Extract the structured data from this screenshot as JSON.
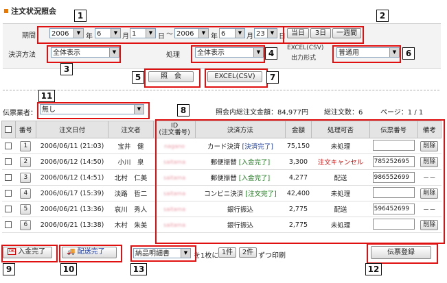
{
  "title": "注文状況照会",
  "period": {
    "label": "期間",
    "from_year": "2006",
    "from_month": "6",
    "from_day": "1",
    "to_year": "2006",
    "to_month": "6",
    "to_day": "23",
    "unit_year": "年",
    "unit_month": "月",
    "unit_day": "日",
    "sep": "～",
    "quick": [
      "当日",
      "3日",
      "一週間"
    ]
  },
  "payment": {
    "label": "決済方法",
    "value": "全体表示"
  },
  "process": {
    "label": "処理",
    "value": "全体表示"
  },
  "excel_format": {
    "label1": "EXCEL(CSV)",
    "label2": "出力形式",
    "value": "普通用"
  },
  "actions": {
    "search": "照　会",
    "excel": "EXCEL(CSV)"
  },
  "carrier": {
    "label": "伝票業者：",
    "value": "無し"
  },
  "summary": {
    "total_amount": "照会内総注文金額：84,977円",
    "total_count": "総注文数：6",
    "page": "ページ：1 / 1"
  },
  "columns": [
    "番号",
    "注文日付",
    "注文者",
    "ID\n(注文番号)",
    "決済方法",
    "金額",
    "処理可否",
    "伝票番号",
    "備考"
  ],
  "rows": [
    {
      "num": "1",
      "date": "2006/06/11 (21:03)",
      "name": "宝井　健",
      "id": "nagano",
      "pay": "カード決済",
      "pay_status": "[決済完了]",
      "pay_status_color": "#1f3fa0",
      "amount": "75,150",
      "status": "未処理",
      "status_color": "#222",
      "slip": "",
      "note": "削除"
    },
    {
      "num": "2",
      "date": "2006/06/12 (14:50)",
      "name": "小川　泉",
      "id": "saitama",
      "pay": "郵便振替",
      "pay_status": "[入金完了]",
      "pay_status_color": "#1a7a1a",
      "amount": "3,300",
      "status": "注文キャンセル",
      "status_color": "#d01010",
      "slip": "785252695",
      "note": "削除"
    },
    {
      "num": "3",
      "date": "2006/06/12 (14:51)",
      "name": "北村　仁美",
      "id": "saitama",
      "pay": "郵便振替",
      "pay_status": "[入金完了]",
      "pay_status_color": "#1a7a1a",
      "amount": "4,277",
      "status": "配送",
      "status_color": "#222",
      "slip": "986552699",
      "note": "－－"
    },
    {
      "num": "4",
      "date": "2006/06/17 (15:39)",
      "name": "淡路　哲二",
      "id": "saitama",
      "pay": "コンビニ決済",
      "pay_status": "[注文完了]",
      "pay_status_color": "#1a7a1a",
      "amount": "42,400",
      "status": "未処理",
      "status_color": "#222",
      "slip": "",
      "note": "削除"
    },
    {
      "num": "5",
      "date": "2006/06/21 (13:36)",
      "name": "哀川　秀人",
      "id": "saitama",
      "pay": "銀行振込",
      "pay_status": "",
      "pay_status_color": "#222",
      "amount": "2,775",
      "status": "配送",
      "status_color": "#222",
      "slip": "596452699",
      "note": "－－"
    },
    {
      "num": "6",
      "date": "2006/06/21 (13:38)",
      "name": "木村　朱美",
      "id": "saitama",
      "pay": "銀行振込",
      "pay_status": "",
      "pay_status_color": "#222",
      "amount": "2,775",
      "status": "未処理",
      "status_color": "#222",
      "slip": "",
      "note": "削除"
    }
  ],
  "bottom": {
    "paid": "入金完了",
    "shipped": "配送完了",
    "doc": "納品明細書",
    "per_sheet": "を1枚に",
    "one": "1件",
    "two": "2件",
    "print": "ずつ印刷",
    "register": "伝票登録"
  },
  "callouts": [
    "1",
    "2",
    "3",
    "4",
    "5",
    "6",
    "7",
    "8",
    "9",
    "10",
    "11",
    "12",
    "13"
  ]
}
